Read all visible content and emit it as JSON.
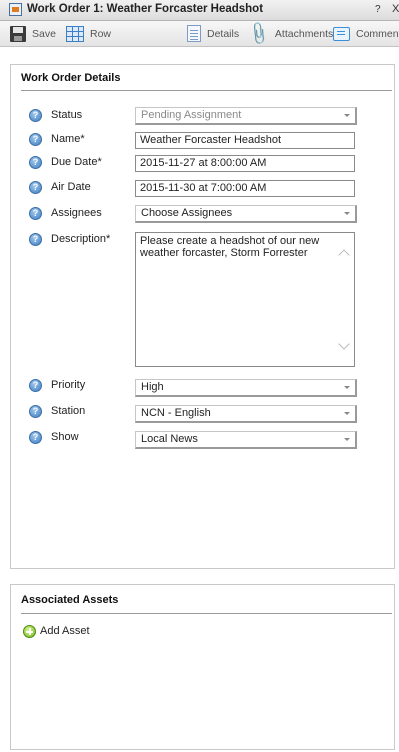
{
  "window": {
    "title": "Work Order 1: Weather Forcaster Headshot",
    "help_glyph": "?",
    "close_glyph": "X"
  },
  "toolbar": {
    "save_label": "Save",
    "row_label": "Row",
    "details_label": "Details",
    "attachments_label": "Attachments",
    "comments_label": "Comments"
  },
  "details": {
    "title": "Work Order Details",
    "help_glyph": "?",
    "fields": {
      "status": {
        "label": "Status",
        "value": "Pending Assignment"
      },
      "name": {
        "label": "Name*",
        "value": "Weather Forcaster Headshot"
      },
      "due_date": {
        "label": "Due Date*",
        "value": "2015-11-27 at 8:00:00 AM"
      },
      "air_date": {
        "label": "Air Date",
        "value": "2015-11-30 at 7:00:00 AM"
      },
      "assignees": {
        "label": "Assignees",
        "value": "Choose Assignees"
      },
      "description": {
        "label": "Description*",
        "value": "Please create a headshot of our new weather forcaster, Storm Forrester"
      },
      "priority": {
        "label": "Priority",
        "value": "High"
      },
      "station": {
        "label": "Station",
        "value": "NCN - English"
      },
      "show": {
        "label": "Show",
        "value": "Local News"
      }
    }
  },
  "assets": {
    "title": "Associated Assets",
    "add_label": "Add Asset"
  },
  "colors": {
    "accent_blue": "#3f7fc2",
    "add_green": "#6fb820"
  }
}
